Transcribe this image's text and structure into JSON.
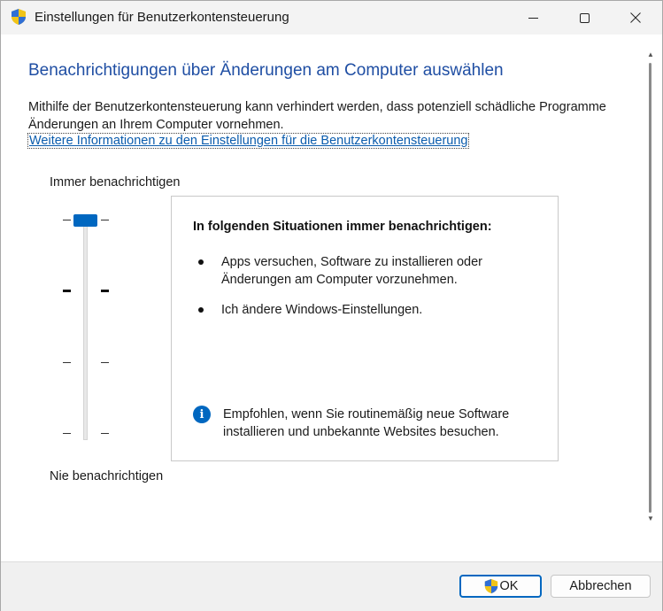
{
  "window": {
    "title": "Einstellungen für Benutzerkontensteuerung",
    "icon": "uac-shield-icon"
  },
  "titlebar_controls": [
    "minimize-icon",
    "maximize-icon",
    "close-icon"
  ],
  "main": {
    "heading": "Benachrichtigungen über Änderungen am Computer auswählen",
    "description": "Mithilfe der Benutzerkontensteuerung kann verhindert werden, dass potenziell schädliche Programme Änderungen an Ihrem Computer vornehmen.",
    "link": "Weitere Informationen zu den Einstellungen für die Benutzerkontensteuerung"
  },
  "slider": {
    "label_top": "Immer benachrichtigen",
    "label_bottom": "Nie benachrichtigen",
    "levels": 4,
    "selected_level": 4
  },
  "infobox": {
    "heading": "In folgenden Situationen immer benachrichtigen:",
    "bullets": [
      "Apps versuchen, Software zu installieren oder Änderungen am Computer vorzunehmen.",
      "Ich ändere Windows-Einstellungen."
    ],
    "recommendation": "Empfohlen, wenn Sie routinemäßig neue Software installieren und unbekannte Websites besuchen.",
    "recommendation_icon": "info-icon"
  },
  "footer": {
    "ok_label": "OK",
    "cancel_label": "Abbrechen"
  },
  "colors": {
    "accent": "#0067c0",
    "heading": "#1f4ea3",
    "link": "#0b5cad"
  }
}
